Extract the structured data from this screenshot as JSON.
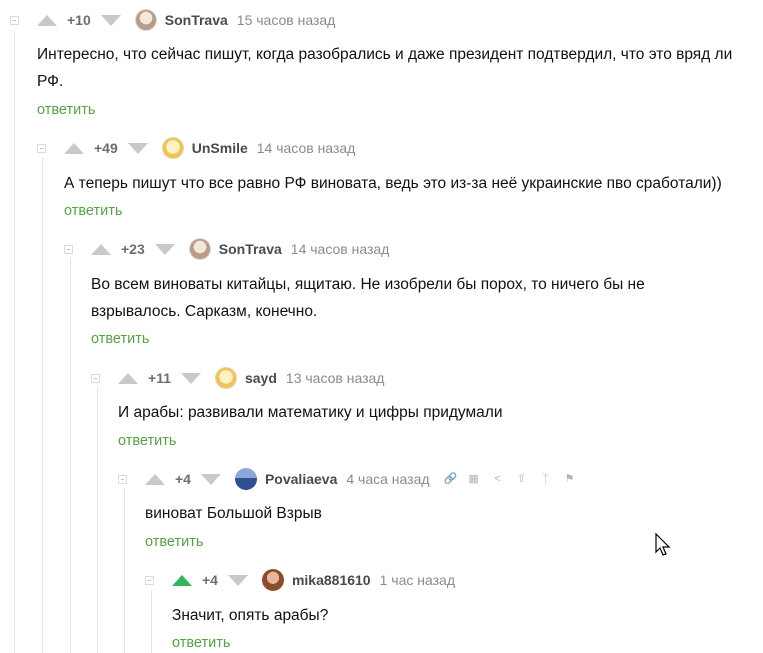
{
  "comments": [
    {
      "rating": "+10",
      "author": "SonTrava",
      "time": "15 часов назад",
      "text": "Интересно, что сейчас пишут, когда разобрались и даже президент подтвердил, что это вряд ли РФ.",
      "reply": "ответить"
    },
    {
      "rating": "+49",
      "author": "UnSmile",
      "time": "14 часов назад",
      "text": "А теперь пишут что все равно РФ виновата, ведь это из-за неё украинские пво сработали))",
      "reply": "ответить"
    },
    {
      "rating": "+23",
      "author": "SonTrava",
      "time": "14 часов назад",
      "text": "Во всем виноваты китайцы, ящитаю. Не изобрели бы порох, то ничего бы не взрывалось. Сарказм, конечно.",
      "reply": "ответить"
    },
    {
      "rating": "+11",
      "author": "sayd",
      "time": "13 часов назад",
      "text": "И арабы: развивали математику и цифры придумали",
      "reply": "ответить"
    },
    {
      "rating": "+4",
      "author": "Povaliaeva",
      "time": "4 часа назад",
      "text": "виноват Большой Взрыв",
      "reply": "ответить"
    },
    {
      "rating": "+4",
      "author": "mika881610",
      "time": "1 час назад",
      "text": "Значит, опять арабы?",
      "reply": "ответить"
    }
  ],
  "tools": [
    "link-icon",
    "save-icon",
    "share-icon",
    "up-icon",
    "branch-icon",
    "flag-icon"
  ],
  "colors": {
    "reply": "#5aa04a",
    "upvote_active": "#34b65c",
    "muted": "#8b8b8b"
  }
}
